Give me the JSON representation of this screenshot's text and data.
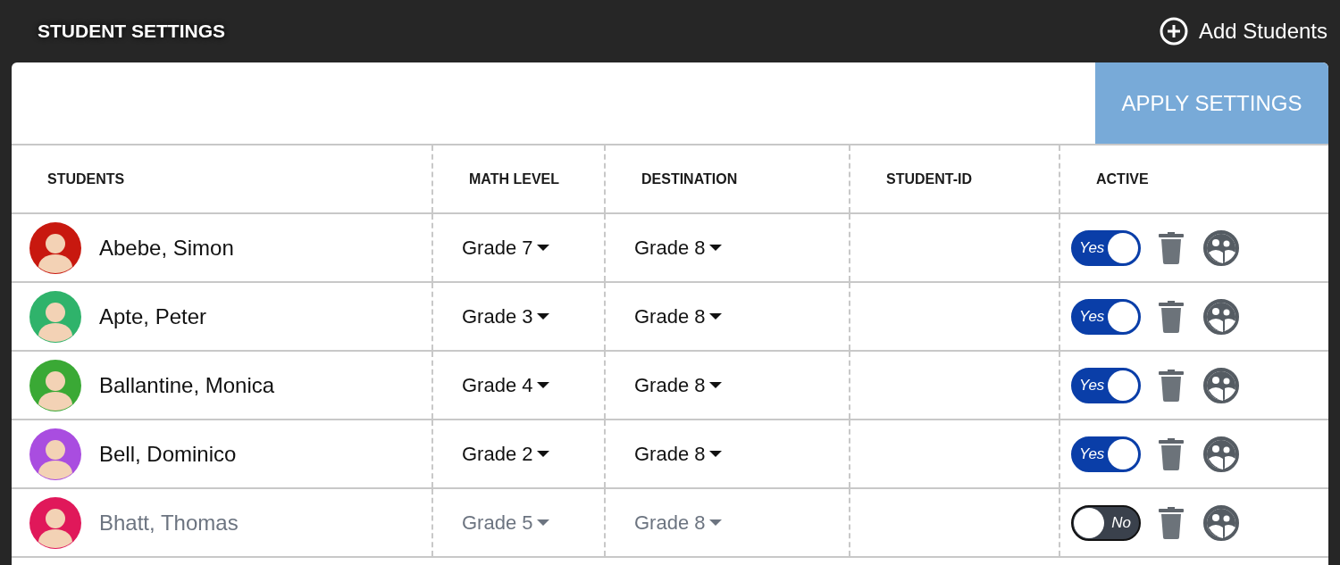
{
  "header": {
    "title": "STUDENT SETTINGS",
    "add_button": "Add Students"
  },
  "apply_button": "APPLY SETTINGS",
  "columns": [
    "STUDENTS",
    "MATH LEVEL",
    "DESTINATION",
    "STUDENT-ID",
    "ACTIVE"
  ],
  "students": [
    {
      "name": "Abebe, Simon",
      "color": "#c8180f",
      "math_level": "Grade 7",
      "destination": "Grade 8",
      "active": true,
      "toggle_label": "Yes"
    },
    {
      "name": "Apte, Peter",
      "color": "#2fb36b",
      "math_level": "Grade 3",
      "destination": "Grade 8",
      "active": true,
      "toggle_label": "Yes"
    },
    {
      "name": "Ballantine, Monica",
      "color": "#3aa935",
      "math_level": "Grade 4",
      "destination": "Grade 8",
      "active": true,
      "toggle_label": "Yes"
    },
    {
      "name": "Bell, Dominico",
      "color": "#a94de0",
      "math_level": "Grade 2",
      "destination": "Grade 8",
      "active": true,
      "toggle_label": "Yes"
    },
    {
      "name": "Bhatt, Thomas",
      "color": "#e0185a",
      "math_level": "Grade 5",
      "destination": "Grade 8",
      "active": false,
      "toggle_label": "No"
    }
  ]
}
